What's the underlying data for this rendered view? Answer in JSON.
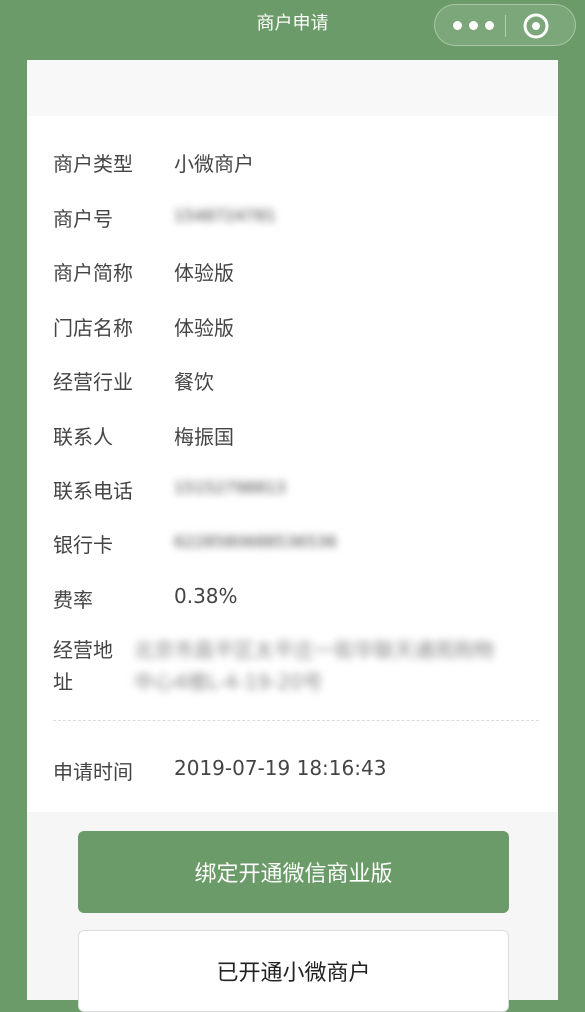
{
  "navbar": {
    "title": "商户申请",
    "more_icon": "more-dots-icon",
    "close_icon": "target-circle-icon"
  },
  "details": {
    "merchant_type": {
      "label": "商户类型",
      "value": "小微商户"
    },
    "merchant_no": {
      "label": "商户号",
      "value": "1548724781"
    },
    "short_name": {
      "label": "商户简称",
      "value": "体验版"
    },
    "store_name": {
      "label": "门店名称",
      "value": "体验版"
    },
    "industry": {
      "label": "经营行业",
      "value": "餐饮"
    },
    "contact": {
      "label": "联系人",
      "value": "梅振国"
    },
    "phone": {
      "label": "联系电话",
      "value": "15152798813"
    },
    "bank_card": {
      "label": "银行卡",
      "value": "6228580688536536"
    },
    "fee_rate": {
      "label": "费率",
      "value": "0.38%"
    },
    "address": {
      "label_line1": "经营地",
      "label_line2": "址",
      "value_line1": "北京市昌平区太平庄一街华联天通苑购物",
      "value_line2": "中心4楼L-4-19-20号"
    },
    "apply_time": {
      "label": "申请时间",
      "value": "2019-07-19 18:16:43"
    }
  },
  "buttons": {
    "primary": "绑定开通微信商业版",
    "secondary": "已开通小微商户"
  },
  "colors": {
    "brand_green": "#6a9b68"
  }
}
